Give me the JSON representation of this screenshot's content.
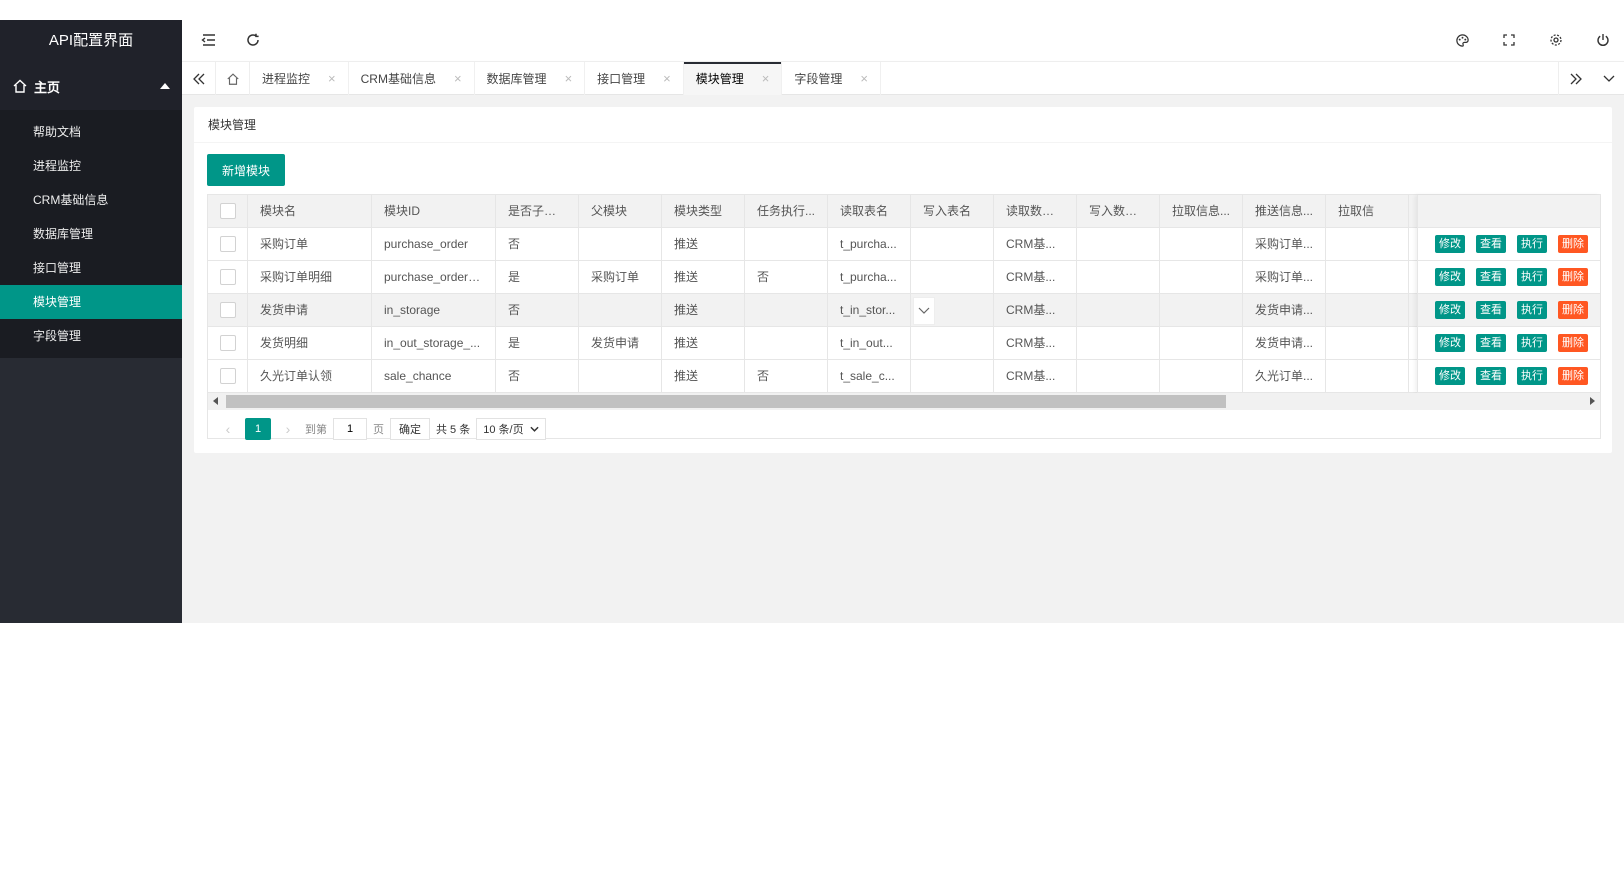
{
  "app": {
    "title": "API配置界面"
  },
  "sidebar": {
    "main_label": "主页",
    "items": [
      {
        "label": "帮助文档"
      },
      {
        "label": "进程监控"
      },
      {
        "label": "CRM基础信息"
      },
      {
        "label": "数据库管理"
      },
      {
        "label": "接口管理"
      },
      {
        "label": "模块管理",
        "active": true
      },
      {
        "label": "字段管理"
      }
    ]
  },
  "tabs": [
    {
      "label": "进程监控"
    },
    {
      "label": "CRM基础信息"
    },
    {
      "label": "数据库管理"
    },
    {
      "label": "接口管理"
    },
    {
      "label": "模块管理",
      "active": true
    },
    {
      "label": "字段管理"
    }
  ],
  "card": {
    "title": "模块管理",
    "add_button": "新增模块"
  },
  "table": {
    "columns": [
      "模块名",
      "模块ID",
      "是否子模块",
      "父模块",
      "模块类型",
      "任务执行...",
      "读取表名",
      "写入表名",
      "读取数据库",
      "写入数据库",
      "拉取信息...",
      "推送信息...",
      "拉取信"
    ],
    "rows": [
      [
        "采购订单",
        "purchase_order",
        "否",
        "",
        "推送",
        "",
        "t_purcha...",
        "",
        "CRM基...",
        "",
        "",
        "采购订单...",
        ""
      ],
      [
        "采购订单明细",
        "purchase_order_...",
        "是",
        "采购订单",
        "推送",
        "否",
        "t_purcha...",
        "",
        "CRM基...",
        "",
        "",
        "采购订单...",
        ""
      ],
      [
        "发货申请",
        "in_storage",
        "否",
        "",
        "推送",
        "",
        "t_in_stor...",
        "",
        "CRM基...",
        "",
        "",
        "发货申请...",
        ""
      ],
      [
        "发货明细",
        "in_out_storage_...",
        "是",
        "发货申请",
        "推送",
        "",
        "t_in_out...",
        "",
        "CRM基...",
        "",
        "",
        "发货申请...",
        ""
      ],
      [
        "久光订单认领",
        "sale_chance",
        "否",
        "",
        "推送",
        "否",
        "t_sale_c...",
        "",
        "CRM基...",
        "",
        "",
        "久光订单...",
        ""
      ]
    ],
    "actions": {
      "edit": "修改",
      "view": "查看",
      "run": "执行",
      "delete": "删除"
    }
  },
  "pager": {
    "current": "1",
    "goto_label": "到第",
    "page_input": "1",
    "page_unit": "页",
    "confirm": "确定",
    "total": "共 5 条",
    "page_size": "10 条/页"
  },
  "colors": {
    "sidebar_bg": "#282b33",
    "accent": "#009688",
    "danger": "#ff5722"
  }
}
